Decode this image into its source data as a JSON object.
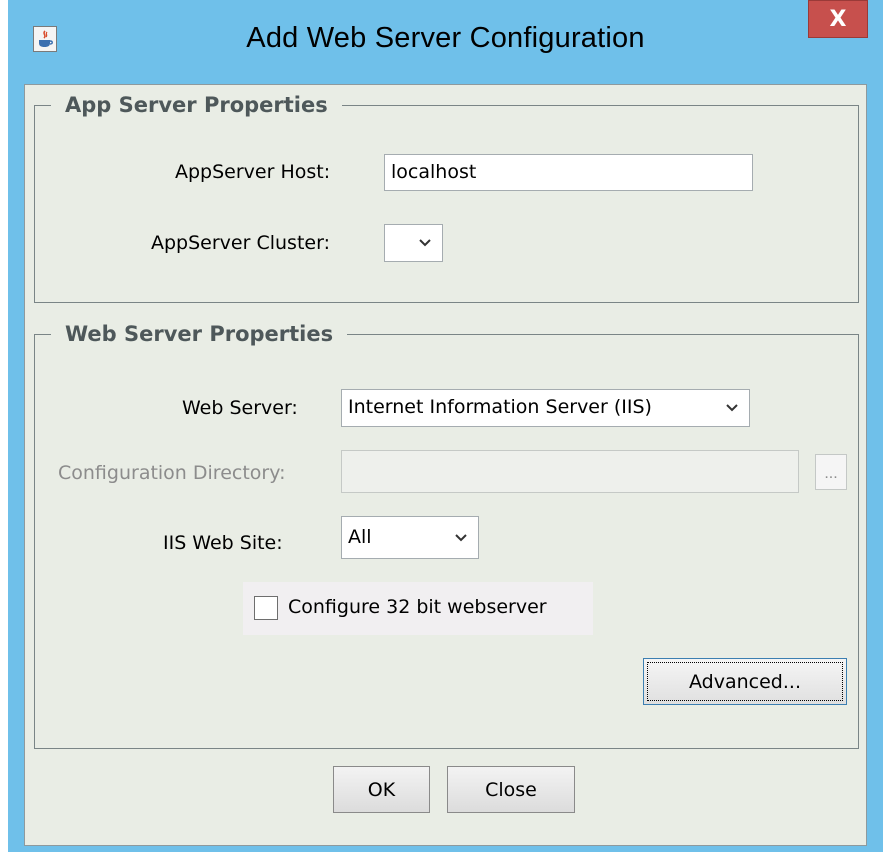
{
  "window": {
    "title": "Add Web Server Configuration",
    "close_label": "X",
    "app_icon": "java-coffee-cup-icon"
  },
  "app_server": {
    "legend": "App Server Properties",
    "host_label": "AppServer Host:",
    "host_value": "localhost",
    "cluster_label": "AppServer Cluster:",
    "cluster_value": ""
  },
  "web_server": {
    "legend": "Web Server Properties",
    "server_label": "Web Server:",
    "server_value": "Internet Information Server (IIS)",
    "config_dir_label": "Configuration Directory:",
    "config_dir_value": "",
    "browse_label": "...",
    "site_label": "IIS Web Site:",
    "site_value": "All",
    "checkbox_label": "Configure 32 bit webserver",
    "checkbox_checked": false,
    "advanced_label": "Advanced..."
  },
  "footer": {
    "ok_label": "OK",
    "close_label": "Close"
  },
  "colors": {
    "title_bar": "#6fc0ea",
    "dialog_bg": "#e9ede5",
    "close_button": "#c7504d",
    "legend_text": "#4e585a"
  }
}
